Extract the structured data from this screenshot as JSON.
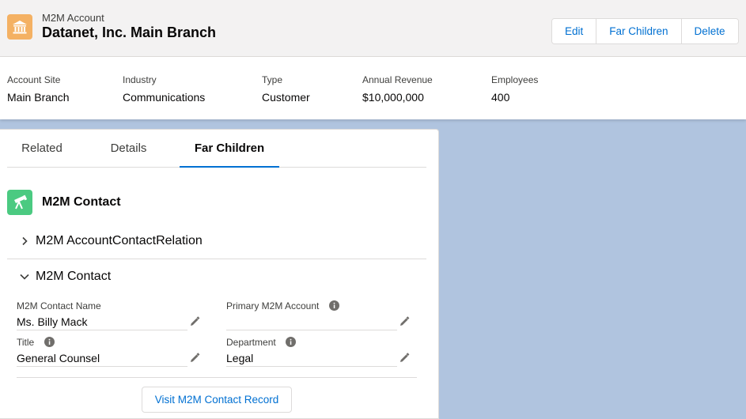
{
  "header": {
    "object_label": "M2M Account",
    "record_title": "Datanet, Inc. Main Branch",
    "account_icon": "bank-icon",
    "buttons": {
      "edit": "Edit",
      "far_children": "Far Children",
      "delete": "Delete"
    }
  },
  "highlights": [
    {
      "label": "Account Site",
      "value": "Main Branch"
    },
    {
      "label": "Industry",
      "value": "Communications"
    },
    {
      "label": "Type",
      "value": "Customer"
    },
    {
      "label": "Annual Revenue",
      "value": "$10,000,000"
    },
    {
      "label": "Employees",
      "value": "400"
    }
  ],
  "tabs": [
    {
      "label": "Related",
      "active": false
    },
    {
      "label": "Details",
      "active": false
    },
    {
      "label": "Far Children",
      "active": true
    }
  ],
  "section": {
    "title": "M2M Contact",
    "icon": "telescope-icon",
    "accordions": [
      {
        "label": "M2M AccountContactRelation",
        "expanded": false
      },
      {
        "label": "M2M Contact",
        "expanded": true
      }
    ]
  },
  "fields": {
    "contact_name": {
      "label": "M2M Contact Name",
      "value": "Ms. Billy Mack"
    },
    "primary_account": {
      "label": "Primary M2M Account",
      "value": ""
    },
    "title": {
      "label": "Title",
      "value": "General Counsel"
    },
    "department": {
      "label": "Department",
      "value": "Legal"
    }
  },
  "visit_button": "Visit M2M Contact Record",
  "colors": {
    "accent": "#0070d2",
    "account_icon_bg": "#f4b163",
    "contact_icon_bg": "#4bca81",
    "background": "#b0c4df"
  }
}
